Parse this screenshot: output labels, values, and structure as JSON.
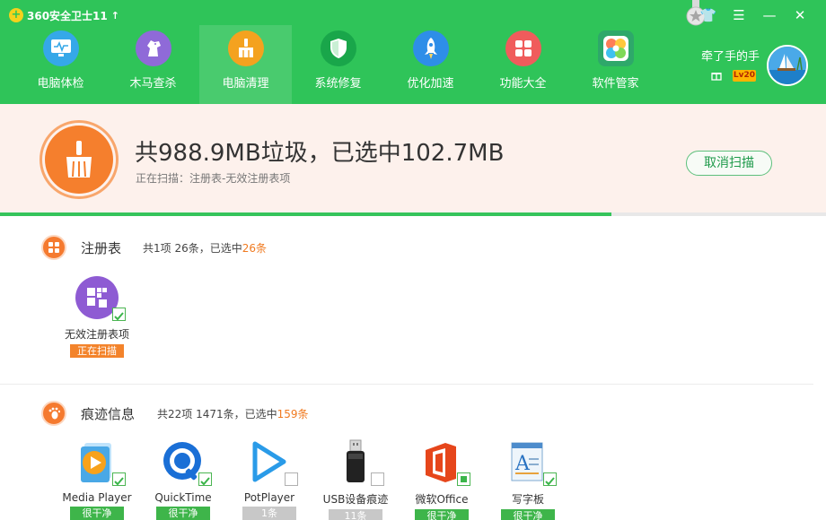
{
  "app": {
    "title": "360安全卫士11",
    "update_arrow": "↑"
  },
  "window_controls": {
    "skin": "👕",
    "menu": "☰",
    "minimize": "—",
    "close": "✕"
  },
  "nav": {
    "items": [
      {
        "label": "电脑体检",
        "icon": "monitor-icon",
        "color": "#35a8e8",
        "active": false
      },
      {
        "label": "木马查杀",
        "icon": "horse-icon",
        "color": "#8f6ad8",
        "active": false
      },
      {
        "label": "电脑清理",
        "icon": "broom-icon",
        "color": "#f4a21f",
        "active": true
      },
      {
        "label": "系统修复",
        "icon": "shield-icon",
        "color": "#19a64a",
        "active": false
      },
      {
        "label": "优化加速",
        "icon": "rocket-icon",
        "color": "#2e8ee8",
        "active": false
      },
      {
        "label": "功能大全",
        "icon": "grid-icon",
        "color": "#f05c5c",
        "active": false
      },
      {
        "label": "软件管家",
        "icon": "flower-icon",
        "color": "#2ea86a",
        "active": false
      }
    ]
  },
  "user": {
    "name": "牵了手的手",
    "level": "Lv20"
  },
  "scan": {
    "title": "共988.9MB垃圾，已选中102.7MB",
    "status": "正在扫描：注册表-无效注册表项",
    "cancel_label": "取消扫描",
    "progress": 0.74,
    "progress_color": "#35c45b"
  },
  "sections": {
    "registry": {
      "title": "注册表",
      "summary_prefix": "共1项 26条，已选中",
      "summary_count": "26条",
      "items": [
        {
          "label": "无效注册表项",
          "tag": "正在扫描",
          "tag_style": "orange",
          "checked": true,
          "icon": "registry-icon"
        }
      ]
    },
    "traces": {
      "title": "痕迹信息",
      "summary_prefix": "共22项 1471条，已选中",
      "summary_count": "159条",
      "items": [
        {
          "label": "Media Player",
          "tag": "很干净",
          "tag_style": "green",
          "checked": true,
          "icon": "media-player-icon"
        },
        {
          "label": "QuickTime",
          "tag": "很干净",
          "tag_style": "green",
          "checked": true,
          "icon": "quicktime-icon"
        },
        {
          "label": "PotPlayer",
          "tag": "1条",
          "tag_style": "gray",
          "checked": false,
          "icon": "potplayer-icon"
        },
        {
          "label": "USB设备痕迹",
          "tag": "11条",
          "tag_style": "gray",
          "checked": false,
          "icon": "usb-icon"
        },
        {
          "label": "微软Office",
          "tag": "很干净",
          "tag_style": "green",
          "checked": "partial",
          "icon": "office-icon"
        },
        {
          "label": "写字板",
          "tag": "很干净",
          "tag_style": "green",
          "checked": true,
          "icon": "wordpad-icon"
        }
      ]
    }
  }
}
